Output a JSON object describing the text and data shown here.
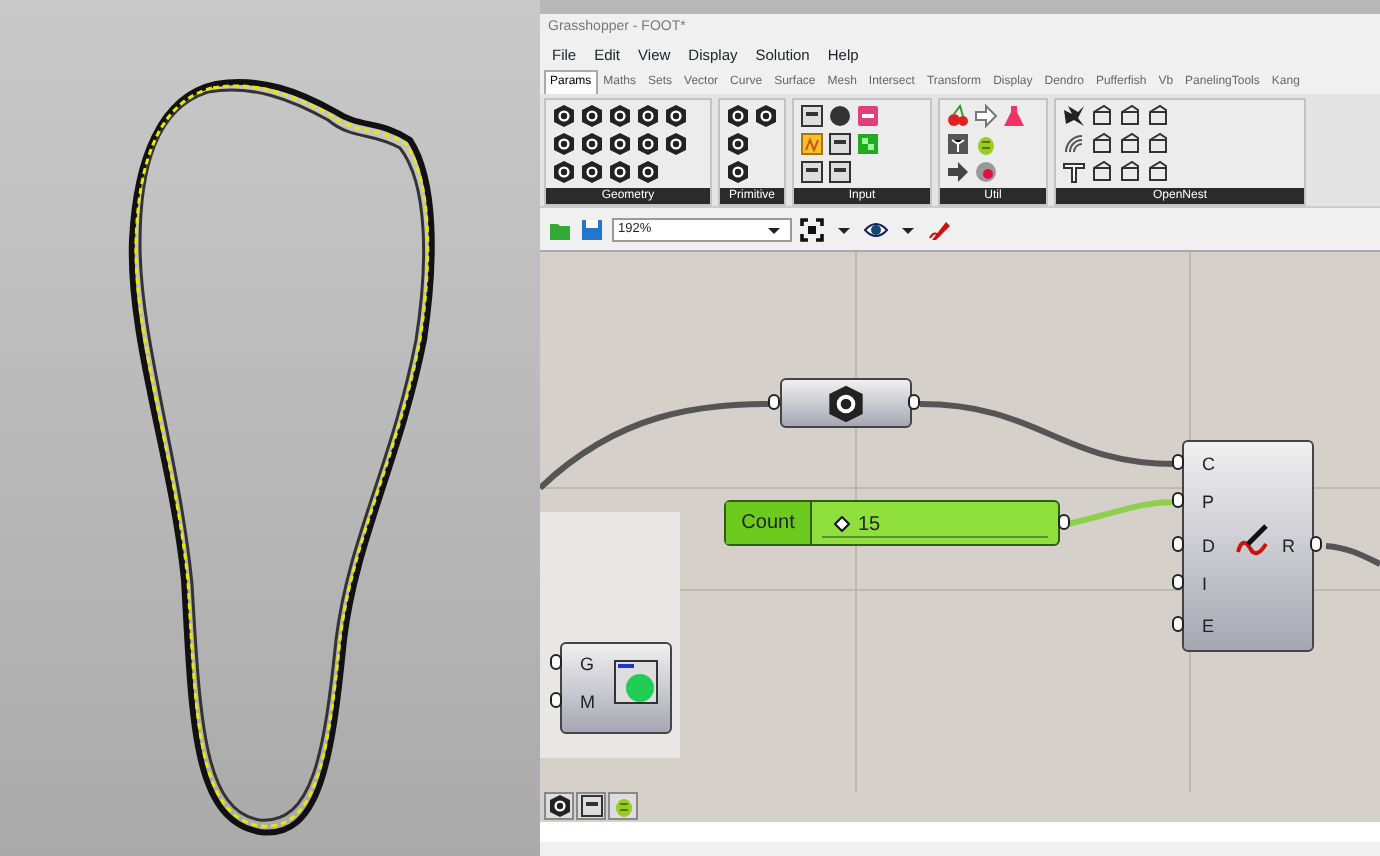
{
  "window": {
    "title": "Grasshopper - FOOT*"
  },
  "menu": [
    "File",
    "Edit",
    "View",
    "Display",
    "Solution",
    "Help"
  ],
  "tabs": [
    {
      "label": "Params",
      "selected": true
    },
    {
      "label": "Maths",
      "selected": false
    },
    {
      "label": "Sets",
      "selected": false
    },
    {
      "label": "Vector",
      "selected": false
    },
    {
      "label": "Curve",
      "selected": false
    },
    {
      "label": "Surface",
      "selected": false
    },
    {
      "label": "Mesh",
      "selected": false
    },
    {
      "label": "Intersect",
      "selected": false
    },
    {
      "label": "Transform",
      "selected": false
    },
    {
      "label": "Display",
      "selected": false
    },
    {
      "label": "Dendro",
      "selected": false
    },
    {
      "label": "Pufferfish",
      "selected": false
    },
    {
      "label": "Vb",
      "selected": false
    },
    {
      "label": "PanelingTools",
      "selected": false
    },
    {
      "label": "Kang",
      "selected": false
    }
  ],
  "ribbon_groups": [
    "Geometry",
    "Primitive",
    "Input",
    "Util",
    "OpenNest"
  ],
  "toolbar": {
    "zoom": "192%"
  },
  "canvas": {
    "slider": {
      "label": "Count",
      "value": "15",
      "level": 0.05
    },
    "component": {
      "inputs": [
        "C",
        "P",
        "D",
        "I",
        "E"
      ],
      "output": "R"
    },
    "material_node": {
      "inputs": [
        "G",
        "M"
      ]
    }
  }
}
